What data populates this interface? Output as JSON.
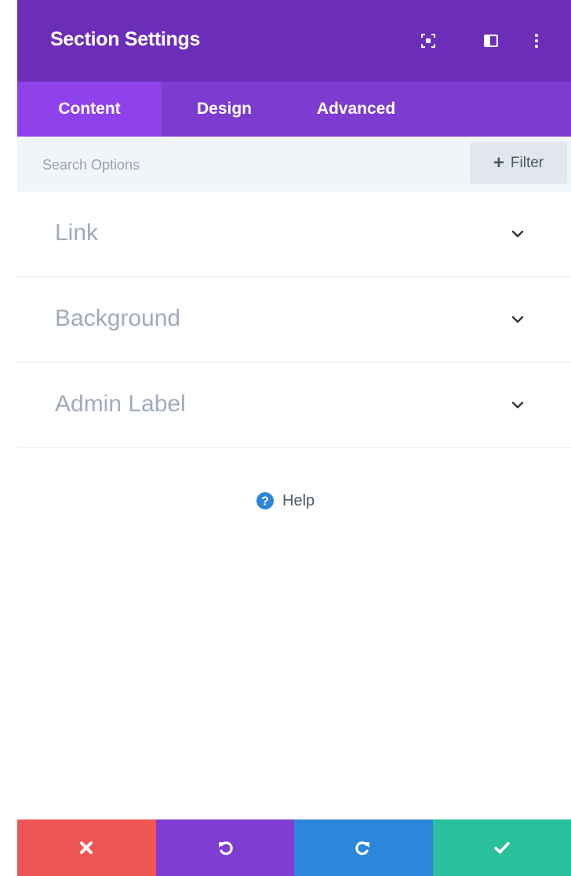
{
  "header": {
    "title": "Section Settings",
    "icons": [
      "expand-icon",
      "split-view-icon",
      "more-options-icon"
    ],
    "background": "#6c2eb9"
  },
  "tabs": [
    {
      "label": "Content",
      "active": true
    },
    {
      "label": "Design",
      "active": false
    },
    {
      "label": "Advanced",
      "active": false
    }
  ],
  "search": {
    "placeholder": "Search Options",
    "value": "",
    "filter_label": "Filter",
    "filter_icon": "plus-icon"
  },
  "toggles": [
    {
      "label": "Link",
      "icon": "chevron-down-icon",
      "expanded": false
    },
    {
      "label": "Background",
      "icon": "chevron-down-icon",
      "expanded": false
    },
    {
      "label": "Admin Label",
      "icon": "chevron-down-icon",
      "expanded": false
    }
  ],
  "help": {
    "label": "Help",
    "icon": "question-circle-icon",
    "color": "#2b87da"
  },
  "footer": [
    {
      "action": "discard",
      "icon": "close-icon",
      "color": "#ef5555"
    },
    {
      "action": "undo",
      "icon": "undo-icon",
      "color": "#7f3dd1"
    },
    {
      "action": "redo",
      "icon": "redo-icon",
      "color": "#2b87da"
    },
    {
      "action": "save",
      "icon": "check-icon",
      "color": "#28c19c"
    }
  ]
}
